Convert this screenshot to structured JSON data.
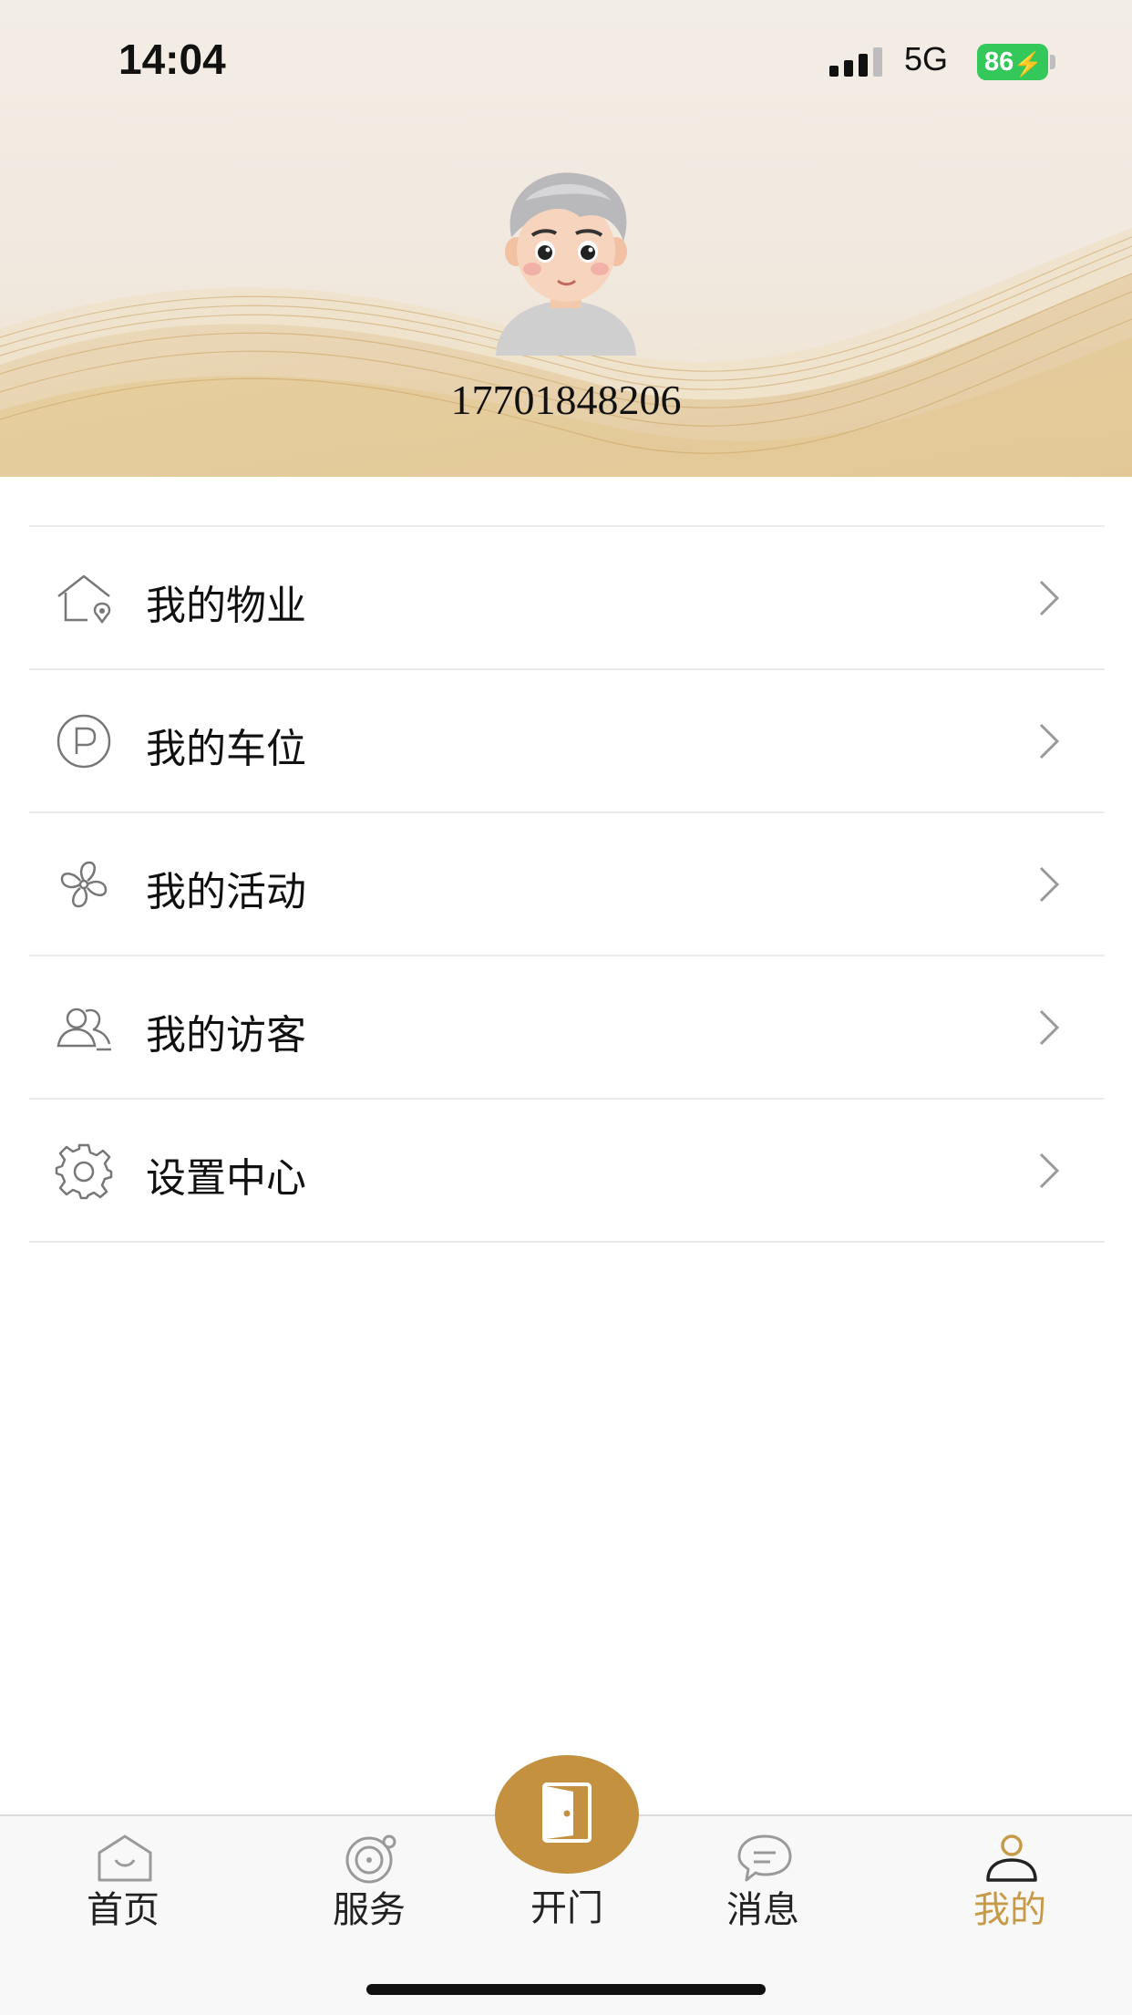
{
  "status_bar": {
    "time": "14:04",
    "network": "5G",
    "battery": "86"
  },
  "profile": {
    "phone": "17701848206",
    "avatar_icon": "cartoon-boy-avatar"
  },
  "menu": {
    "items": [
      {
        "label": "我的物业",
        "icon": "house-location-icon"
      },
      {
        "label": "我的车位",
        "icon": "parking-icon"
      },
      {
        "label": "我的活动",
        "icon": "pinwheel-icon"
      },
      {
        "label": "我的访客",
        "icon": "visitors-icon"
      },
      {
        "label": "设置中心",
        "icon": "gear-icon"
      }
    ]
  },
  "tabbar": {
    "home": "首页",
    "service": "服务",
    "door": "开门",
    "messages": "消息",
    "mine": "我的",
    "active": "mine",
    "active_color": "#c69a47",
    "door_color": "#c3913f"
  }
}
